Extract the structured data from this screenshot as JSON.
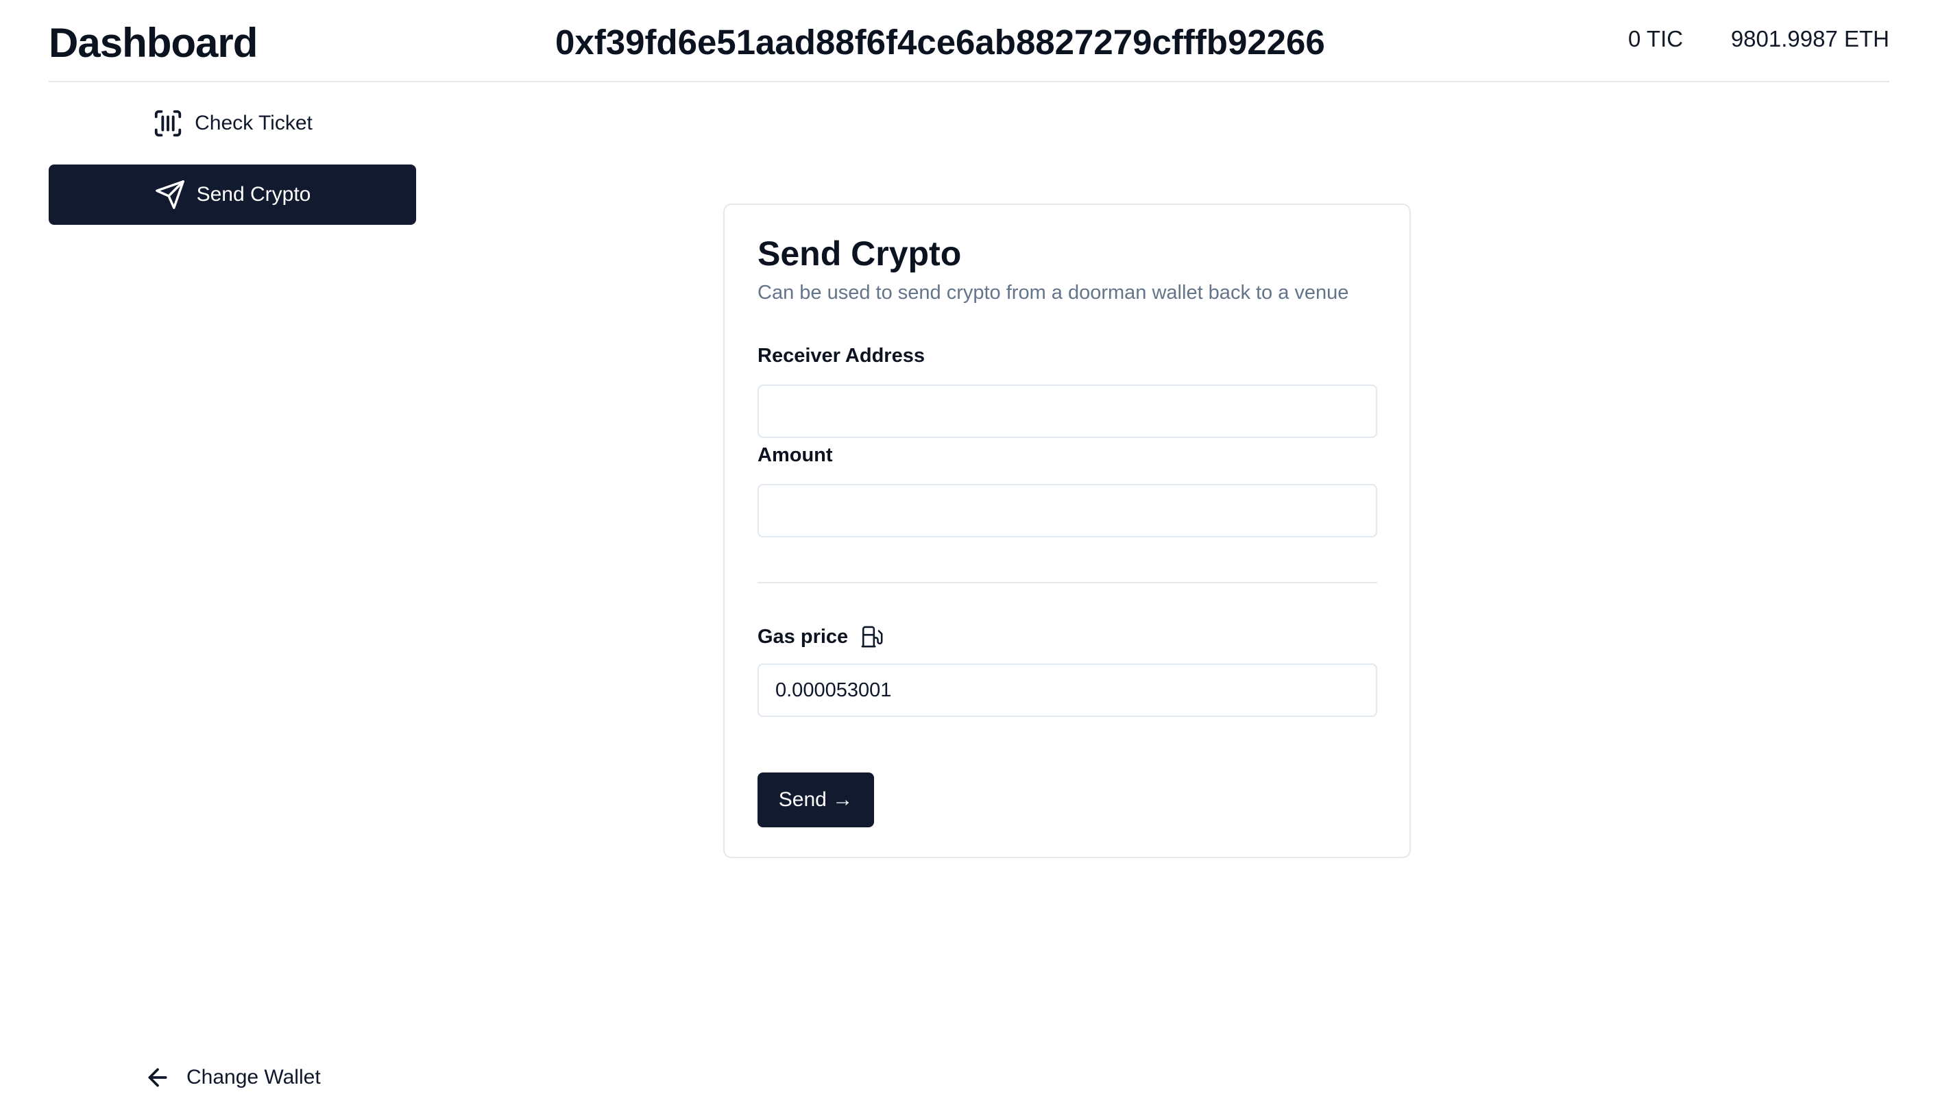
{
  "header": {
    "title": "Dashboard",
    "wallet_address": "0xf39fd6e51aad88f6f4ce6ab8827279cfffb92266",
    "tic_balance": "0 TIC",
    "eth_balance": "9801.9987 ETH"
  },
  "sidebar": {
    "items": [
      {
        "label": "Check Ticket",
        "icon": "scan-barcode-icon",
        "active": false
      },
      {
        "label": "Send Crypto",
        "icon": "send-icon",
        "active": true
      }
    ],
    "footer": {
      "label": "Change Wallet",
      "icon": "arrow-left-icon"
    }
  },
  "card": {
    "title": "Send Crypto",
    "subtitle": "Can be used to send crypto from a doorman wallet back to a venue",
    "receiver_label": "Receiver Address",
    "receiver_value": "",
    "amount_label": "Amount",
    "amount_value": "",
    "gas_label": "Gas price",
    "gas_icon": "fuel-icon",
    "gas_value": "0.000053001",
    "send_label": "Send →"
  },
  "colors": {
    "primary": "#111a2e",
    "muted_text": "#64748b",
    "border": "#e5e7eb"
  }
}
